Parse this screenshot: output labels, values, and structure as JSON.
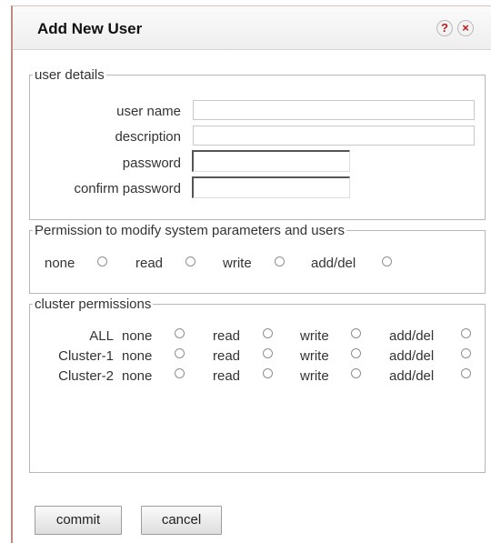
{
  "dialog": {
    "title": "Add New User",
    "help_icon": "question-mark-icon",
    "close_icon": "close-x-icon"
  },
  "user_details": {
    "legend": "user details",
    "user_name_label": "user name",
    "description_label": "description",
    "password_label": "password",
    "confirm_password_label": "confirm password",
    "user_name_value": "",
    "description_value": "",
    "password_value": "",
    "confirm_password_value": ""
  },
  "system_permission": {
    "legend": "Permission to modify system parameters and users",
    "options": [
      "none",
      "read",
      "write",
      "add/del"
    ],
    "selected": null
  },
  "cluster_permissions": {
    "legend": "cluster permissions",
    "options": [
      "none",
      "read",
      "write",
      "add/del"
    ],
    "rows": [
      {
        "label": "ALL",
        "selected": null
      },
      {
        "label": "Cluster-1",
        "selected": null
      },
      {
        "label": "Cluster-2",
        "selected": null
      }
    ]
  },
  "buttons": {
    "commit": "commit",
    "cancel": "cancel"
  }
}
